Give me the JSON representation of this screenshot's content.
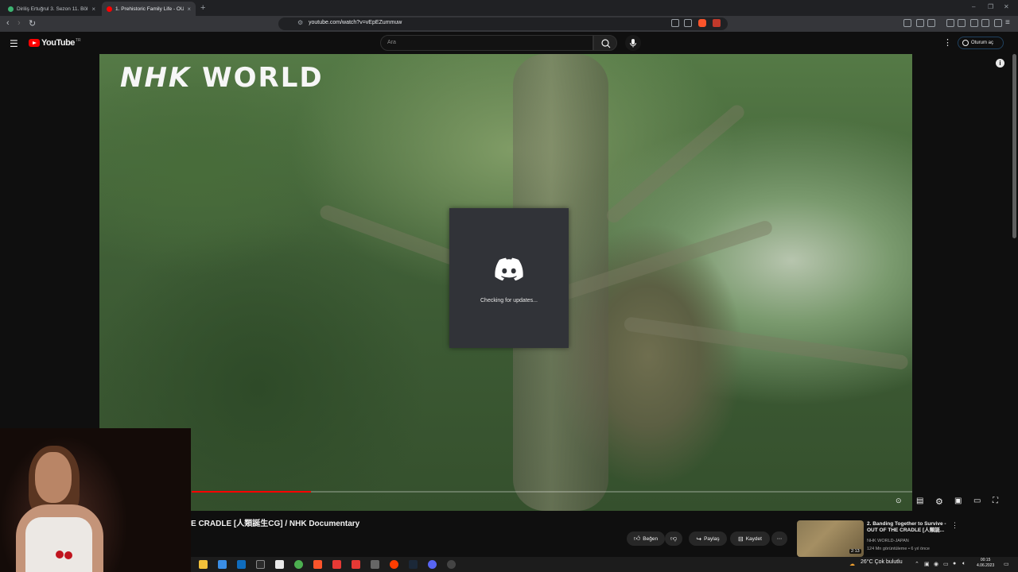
{
  "browser": {
    "tabs": [
      {
        "title": "Diriliş Ertuğrul 3. Sezon 11. Bölüm Türkçe Alt...",
        "active": false,
        "favicon_color": "#3cb371"
      },
      {
        "title": "1. Prehistoric Family Life - OUT O...",
        "active": true,
        "favicon_color": "#ff0000"
      }
    ],
    "new_tab_icon": "plus-icon",
    "url": "youtube.com/watch?v=vEpEZummuw"
  },
  "youtube": {
    "logo_text": "YouTube",
    "logo_region": "TR",
    "search_placeholder": "Ara",
    "signin_label": "Oturum aç"
  },
  "video": {
    "watermark_part1": "NHK",
    "watermark_part2": "WORLD",
    "progress_fraction": 0.166,
    "title_visible": "E CRADLE [人類誕生CG] / NHK Documentary"
  },
  "discord_updater": {
    "status": "Checking for updates...",
    "brand_color": "#313338"
  },
  "actions": {
    "like": "Beğen",
    "share": "Paylaş",
    "save": "Kaydet"
  },
  "recommendation": {
    "title": "2. Banding Together to Survive - OUT OF THE CRADLE [人類誕...",
    "duration": "2:13",
    "channel": "NHK WORLD-JAPAN",
    "meta": "124 Mn görüntüleme • 6 yıl önce"
  },
  "taskbar": {
    "weather": "26°C  Çok bulutlu",
    "time": "00:15",
    "date": "4.06.2023"
  }
}
